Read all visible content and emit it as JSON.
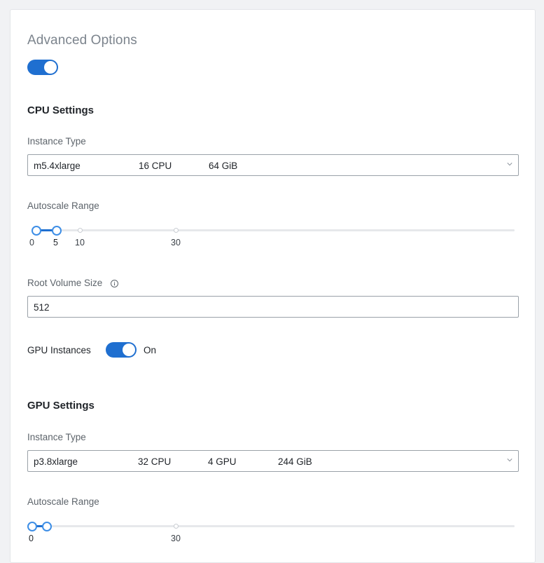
{
  "advanced": {
    "title": "Advanced Options",
    "toggle_on": true
  },
  "cpu": {
    "title": "CPU Settings",
    "instance_label": "Instance Type",
    "instance": {
      "name": "m5.4xlarge",
      "cpu": "16 CPU",
      "mem": "64 GiB"
    },
    "autoscale_label": "Autoscale Range",
    "autoscale": {
      "min": 0,
      "max": 5,
      "ticks": [
        "0",
        "5",
        "10",
        "30"
      ]
    },
    "root_volume_label": "Root Volume Size",
    "root_volume_value": "512",
    "gpu_instances_label": "GPU Instances",
    "gpu_instances_state": "On"
  },
  "gpu": {
    "title": "GPU Settings",
    "instance_label": "Instance Type",
    "instance": {
      "name": "p3.8xlarge",
      "cpu": "32 CPU",
      "gpu": "4 GPU",
      "mem": "244 GiB"
    },
    "autoscale_label": "Autoscale Range",
    "autoscale": {
      "min": 0,
      "max": 1,
      "ticks": [
        "0",
        "30"
      ]
    }
  },
  "colors": {
    "accent": "#1f6fd0",
    "thumb_border": "#3d8ee6"
  },
  "icons": {
    "info": "info-icon",
    "chevron": "chevron-down-icon"
  }
}
